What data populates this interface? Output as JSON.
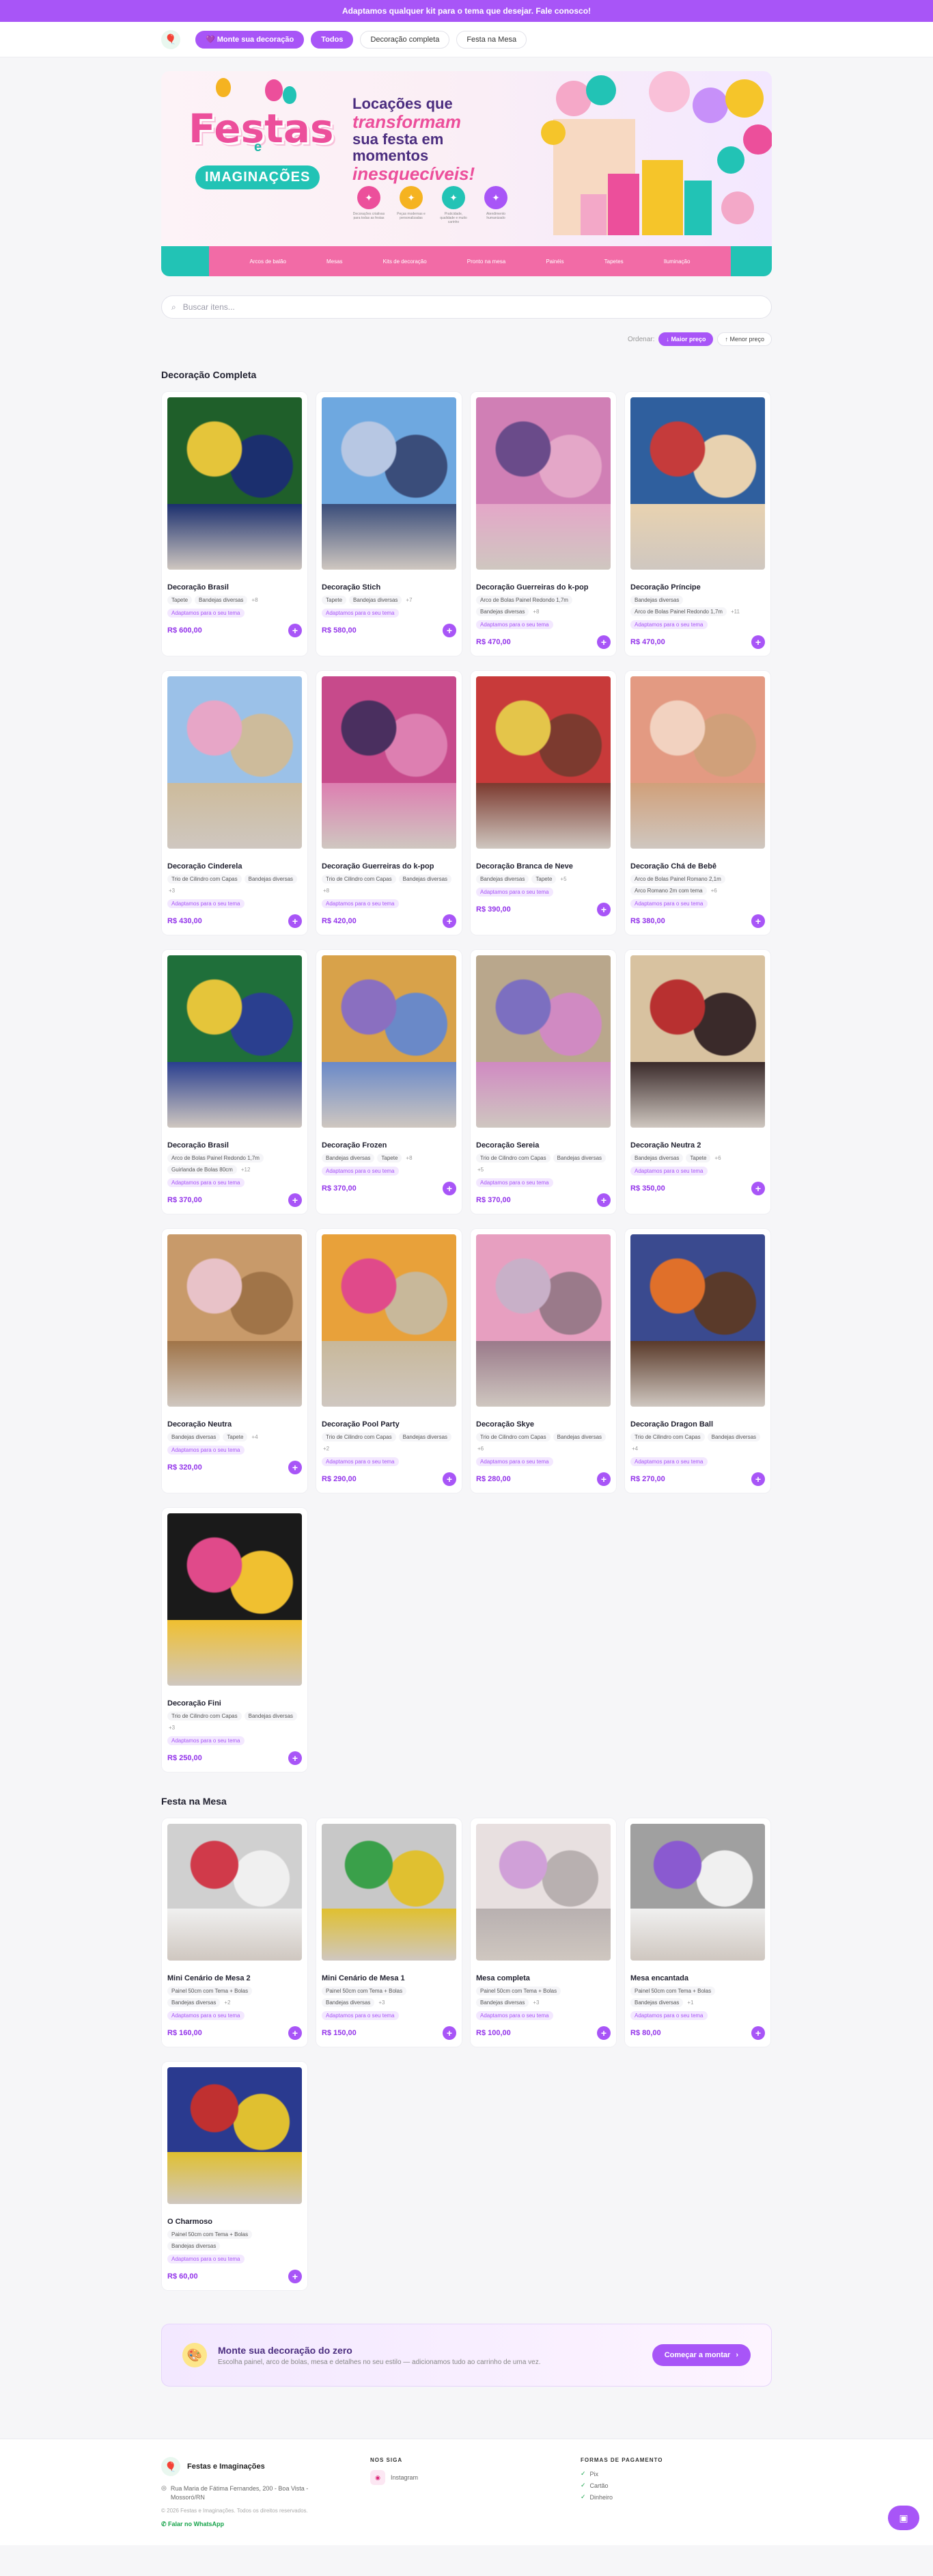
{
  "announcement": "Adaptamos qualquer kit para o tema que desejar. Fale conosco!",
  "nav": {
    "build_btn": "Monte sua decoração",
    "tabs": [
      "Todos",
      "Decoração completa",
      "Festa na Mesa"
    ]
  },
  "hero": {
    "brand1": "Festas",
    "brand_e": "e",
    "brand2": "IMAGINAÇÕES",
    "tag1": "Locações que",
    "tag2": "transformam",
    "tag3": "sua festa em momentos",
    "tag4": "inesquecíveis!",
    "features": [
      {
        "t": "Decorações criativas para todas as festas",
        "c": "#ec4f9b"
      },
      {
        "t": "Peças modernas e personalizadas",
        "c": "#f5b321"
      },
      {
        "t": "Praticidade, qualidade e muito carinho",
        "c": "#22c3b5"
      },
      {
        "t": "Atendimento humanizado",
        "c": "#a855f7"
      }
    ],
    "strip": [
      "Arcos de balão",
      "Mesas",
      "Kits de decoração",
      "Pronto na mesa",
      "Painéis",
      "Tapetes",
      "Iluminação"
    ]
  },
  "search": {
    "placeholder": "Buscar itens..."
  },
  "sort": {
    "label": "Ordenar:",
    "high": "Maior preço",
    "low": "Menor preço"
  },
  "sections": [
    {
      "title": "Decoração Completa",
      "items": [
        {
          "name": "Decoração Brasil",
          "chips": [
            "Tapete",
            "Bandejas diversas"
          ],
          "more": "+8",
          "price": "R$ 600,00",
          "colors": [
            "#1f5f2a",
            "#e5c53a",
            "#1b2f6e"
          ]
        },
        {
          "name": "Decoração Stich",
          "chips": [
            "Tapete",
            "Bandejas diversas"
          ],
          "more": "+7",
          "price": "R$ 580,00",
          "colors": [
            "#6ea8e0",
            "#b7c7e3",
            "#3a4d7a"
          ]
        },
        {
          "name": "Decoração Guerreiras do k-pop",
          "chips": [
            "Arco de Bolas Painel Redondo 1,7m",
            "Bandejas diversas"
          ],
          "more": "+8",
          "price": "R$ 470,00",
          "colors": [
            "#d07fb5",
            "#6a4b8a",
            "#e4a7c8"
          ]
        },
        {
          "name": "Decoração Príncipe",
          "chips": [
            "Bandejas diversas",
            "Arco de Bolas Painel Redondo 1,7m"
          ],
          "more": "+11",
          "price": "R$ 470,00",
          "colors": [
            "#2f5f9e",
            "#c53b3b",
            "#e8d2b0"
          ]
        },
        {
          "name": "Decoração Cinderela",
          "chips": [
            "Trio de Cilindro com Capas",
            "Bandejas diversas"
          ],
          "more": "+3",
          "price": "R$ 430,00",
          "colors": [
            "#9bc1e8",
            "#e7a6c7",
            "#cdbb9b"
          ]
        },
        {
          "name": "Decoração Guerreiras do k-pop",
          "chips": [
            "Trio de Cilindro com Capas",
            "Bandejas diversas"
          ],
          "more": "+8",
          "price": "R$ 420,00",
          "colors": [
            "#c74a8b",
            "#4a2f5f",
            "#dd7fb1"
          ]
        },
        {
          "name": "Decoração Branca de Neve",
          "chips": [
            "Bandejas diversas",
            "Tapete"
          ],
          "more": "+5",
          "price": "R$ 390,00",
          "colors": [
            "#c83a3a",
            "#e4c54a",
            "#7c3a2f"
          ]
        },
        {
          "name": "Decoração Chá de Bebê",
          "chips": [
            "Arco de Bolas Painel Romano 2,1m",
            "Arco Romano 2m com tema"
          ],
          "more": "+6",
          "price": "R$ 380,00",
          "colors": [
            "#e39a82",
            "#f2d2c0",
            "#d0a07a"
          ]
        },
        {
          "name": "Decoração Brasil",
          "chips": [
            "Arco de Bolas Painel Redondo 1,7m",
            "Guirlanda de Bolas 80cm"
          ],
          "more": "+12",
          "price": "R$ 370,00",
          "colors": [
            "#1f6f3a",
            "#e5c53a",
            "#2a3f8f"
          ]
        },
        {
          "name": "Decoração Frozen",
          "chips": [
            "Bandejas diversas",
            "Tapete"
          ],
          "more": "+8",
          "price": "R$ 370,00",
          "colors": [
            "#d8a24a",
            "#8a6fc0",
            "#6a89c8"
          ]
        },
        {
          "name": "Decoração Sereia",
          "chips": [
            "Trio de Cilindro com Capas",
            "Bandejas diversas"
          ],
          "more": "+5",
          "price": "R$ 370,00",
          "colors": [
            "#b9a78c",
            "#7c6fc0",
            "#d08ac2"
          ]
        },
        {
          "name": "Decoração Neutra 2",
          "chips": [
            "Bandejas diversas",
            "Tapete"
          ],
          "more": "+6",
          "price": "R$ 350,00",
          "colors": [
            "#d8c2a0",
            "#b83030",
            "#3a2a2a"
          ]
        },
        {
          "name": "Decoração Neutra",
          "chips": [
            "Bandejas diversas",
            "Tapete"
          ],
          "more": "+4",
          "price": "R$ 320,00",
          "colors": [
            "#c89a6a",
            "#e8c2c8",
            "#a07448"
          ]
        },
        {
          "name": "Decoração Pool Party",
          "chips": [
            "Trio de Cilindro com Capas",
            "Bandejas diversas"
          ],
          "more": "+2",
          "price": "R$ 290,00",
          "colors": [
            "#e8a13a",
            "#e04a8a",
            "#c8b89a"
          ]
        },
        {
          "name": "Decoração Skye",
          "chips": [
            "Trio de Cilindro com Capas",
            "Bandejas diversas"
          ],
          "more": "+6",
          "price": "R$ 280,00",
          "colors": [
            "#e79fc0",
            "#c8b0c8",
            "#9a7a8a"
          ]
        },
        {
          "name": "Decoração Dragon Ball",
          "chips": [
            "Trio de Cilindro com Capas",
            "Bandejas diversas"
          ],
          "more": "+4",
          "price": "R$ 270,00",
          "colors": [
            "#3a4a8f",
            "#e0702a",
            "#5a3a2a"
          ]
        },
        {
          "name": "Decoração Fini",
          "chips": [
            "Trio de Cilindro com Capas",
            "Bandejas diversas"
          ],
          "more": "+3",
          "price": "R$ 250,00",
          "colors": [
            "#1a1a1a",
            "#e04a8a",
            "#f0c030"
          ]
        }
      ]
    },
    {
      "title": "Festa na Mesa",
      "items": [
        {
          "name": "Mini Cenário de Mesa 2",
          "chips": [
            "Painel 50cm com Tema + Bolas",
            "Bandejas diversas"
          ],
          "more": "+2",
          "price": "R$ 160,00",
          "colors": [
            "#d0d0d0",
            "#d03a4a",
            "#f0f0f0"
          ]
        },
        {
          "name": "Mini Cenário de Mesa 1",
          "chips": [
            "Painel 50cm com Tema + Bolas",
            "Bandejas diversas"
          ],
          "more": "+3",
          "price": "R$ 150,00",
          "colors": [
            "#c8c8c8",
            "#3aa04a",
            "#e0c030"
          ]
        },
        {
          "name": "Mesa completa",
          "chips": [
            "Painel 50cm com Tema + Bolas",
            "Bandejas diversas"
          ],
          "more": "+3",
          "price": "R$ 100,00",
          "colors": [
            "#e8e0e0",
            "#d0a0d8",
            "#b8b0b0"
          ]
        },
        {
          "name": "Mesa encantada",
          "chips": [
            "Painel 50cm com Tema + Bolas",
            "Bandejas diversas"
          ],
          "more": "+1",
          "price": "R$ 80,00",
          "colors": [
            "#a0a0a0",
            "#8a5ad0",
            "#f0f0f0"
          ]
        },
        {
          "name": "O Charmoso",
          "chips": [
            "Painel 50cm com Tema + Bolas",
            "Bandejas diversas"
          ],
          "more": "",
          "price": "R$ 60,00",
          "colors": [
            "#2a3a8f",
            "#c03030",
            "#e0c030"
          ]
        }
      ]
    }
  ],
  "adapt_label": "Adaptamos para o seu tema",
  "cta": {
    "title": "Monte sua decoração do zero",
    "sub": "Escolha painel, arco de bolas, mesa e detalhes no seu estilo — adicionamos tudo ao carrinho de uma vez.",
    "btn": "Começar a montar"
  },
  "footer": {
    "brand": "Festas e Imaginações",
    "address": "Rua Maria de Fátima Fernandes, 200 - Boa Vista - Mossoró/RN",
    "copy": "© 2026 Festas e Imaginações. Todos os direitos reservados.",
    "whatsapp": "Falar no WhatsApp",
    "follow_h": "NOS SIGA",
    "instagram": "Instagram",
    "pay_h": "FORMAS DE PAGAMENTO",
    "pay": [
      "Pix",
      "Cartão",
      "Dinheiro"
    ]
  }
}
